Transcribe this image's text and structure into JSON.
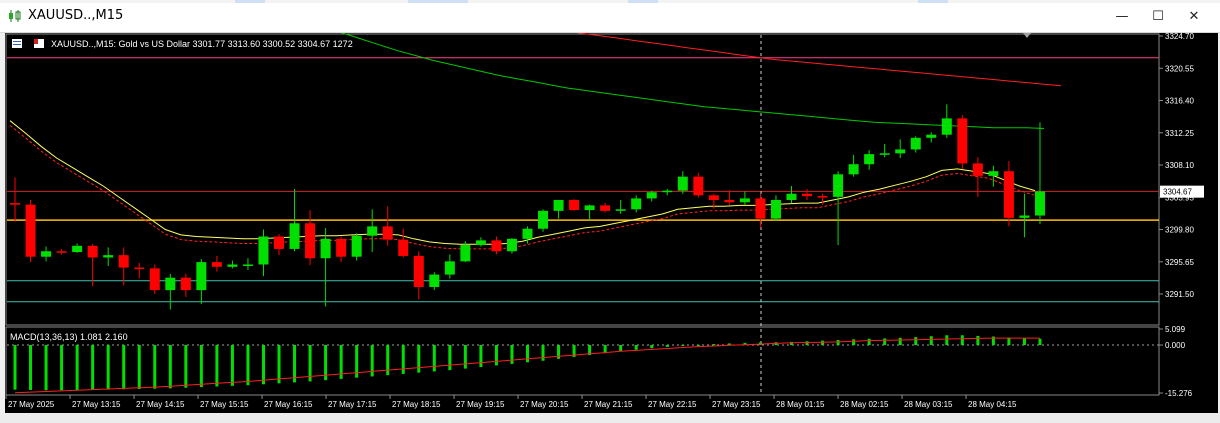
{
  "window": {
    "title": "XAUUSD..,M15",
    "minimize_glyph": "—",
    "maximize_glyph": "☐",
    "close_glyph": "✕"
  },
  "chart_header": {
    "symbol_text": "XAUUSD..,M15:  Gold vs US Dollar  3301.77 3313.60 3300.52 3304.67  1272"
  },
  "price_axis": {
    "labels": [
      "3324.70",
      "3320.55",
      "3316.40",
      "3312.25",
      "3308.10",
      "3303.95",
      "3299.80",
      "3295.65",
      "3291.50"
    ],
    "current_price": "3304.67"
  },
  "macd_panel": {
    "label": "MACD(13,36,13) 1.081 2.160",
    "axis_labels": [
      "5.099",
      "0.000",
      "-15.276"
    ]
  },
  "time_axis": {
    "labels": [
      "27 May 2025",
      "27 May 13:15",
      "27 May 14:15",
      "27 May 15:15",
      "27 May 16:15",
      "27 May 17:15",
      "27 May 18:15",
      "27 May 19:15",
      "27 May 20:15",
      "27 May 21:15",
      "27 May 22:15",
      "27 May 23:15",
      "28 May 01:15",
      "28 May 02:15",
      "28 May 03:15",
      "28 May 04:15"
    ]
  },
  "colors": {
    "background": "#000000",
    "bull": "#00e000",
    "bear": "#ff0000",
    "ma_fast": "#ffff66",
    "ma_slow": "#00c800",
    "ma_long": "#ff2020",
    "hline_magenta": "#ff3c8c",
    "hline_red": "#c82828",
    "hline_gold": "#ffc000",
    "hline_cyan": "#40c0b0",
    "macd_hist": "#00e000",
    "macd_signal": "#ff2020"
  },
  "chart_data": {
    "type": "candlestick",
    "y_range": [
      3289.5,
      3325.5
    ],
    "candles": [
      [
        3303.2,
        3306.5,
        3300.8,
        3303.0
      ],
      [
        3303.0,
        3303.6,
        3295.6,
        3296.3
      ],
      [
        3296.3,
        3297.6,
        3295.7,
        3297.0
      ],
      [
        3297.0,
        3297.3,
        3296.6,
        3296.9
      ],
      [
        3296.9,
        3298.0,
        3296.8,
        3297.7
      ],
      [
        3297.7,
        3297.9,
        3292.5,
        3296.2
      ],
      [
        3296.2,
        3297.5,
        3295.1,
        3296.5
      ],
      [
        3296.5,
        3297.5,
        3292.6,
        3294.9
      ],
      [
        3294.9,
        3295.5,
        3293.5,
        3294.8
      ],
      [
        3294.8,
        3295.3,
        3291.5,
        3292.0
      ],
      [
        3292.0,
        3294.1,
        3289.5,
        3293.6
      ],
      [
        3293.6,
        3294.1,
        3291.1,
        3292.0
      ],
      [
        3292.0,
        3296.0,
        3290.2,
        3295.6
      ],
      [
        3295.6,
        3296.4,
        3294.4,
        3295.0
      ],
      [
        3295.0,
        3295.8,
        3294.8,
        3295.3
      ],
      [
        3295.3,
        3296.1,
        3294.6,
        3295.3
      ],
      [
        3295.3,
        3299.8,
        3293.8,
        3298.9
      ],
      [
        3298.9,
        3299.2,
        3296.5,
        3297.3
      ],
      [
        3297.3,
        3305.0,
        3297.0,
        3300.6
      ],
      [
        3300.6,
        3302.3,
        3295.2,
        3296.1
      ],
      [
        3296.1,
        3300.0,
        3289.9,
        3298.6
      ],
      [
        3298.6,
        3298.9,
        3295.6,
        3296.3
      ],
      [
        3296.3,
        3299.3,
        3295.8,
        3299.0
      ],
      [
        3299.0,
        3302.4,
        3296.9,
        3300.2
      ],
      [
        3300.2,
        3302.8,
        3297.7,
        3298.5
      ],
      [
        3298.5,
        3299.9,
        3296.2,
        3296.4
      ],
      [
        3296.4,
        3297.0,
        3290.8,
        3292.4
      ],
      [
        3292.4,
        3294.3,
        3292.0,
        3294.0
      ],
      [
        3294.0,
        3296.6,
        3293.5,
        3295.7
      ],
      [
        3295.7,
        3298.3,
        3295.6,
        3297.8
      ],
      [
        3297.8,
        3298.8,
        3297.6,
        3298.4
      ],
      [
        3298.4,
        3298.9,
        3296.6,
        3297.0
      ],
      [
        3297.0,
        3298.7,
        3296.7,
        3298.6
      ],
      [
        3298.6,
        3300.2,
        3298.0,
        3299.9
      ],
      [
        3299.9,
        3302.4,
        3299.5,
        3302.2
      ],
      [
        3302.2,
        3303.0,
        3301.2,
        3303.6
      ],
      [
        3303.6,
        3303.7,
        3302.2,
        3302.3
      ],
      [
        3302.3,
        3303.0,
        3301.0,
        3302.9
      ],
      [
        3302.9,
        3303.2,
        3302.0,
        3302.2
      ],
      [
        3302.2,
        3303.6,
        3301.8,
        3302.4
      ],
      [
        3302.4,
        3304.2,
        3302.0,
        3303.8
      ],
      [
        3303.8,
        3304.8,
        3303.4,
        3304.6
      ],
      [
        3304.6,
        3305.0,
        3304.2,
        3304.8
      ],
      [
        3304.8,
        3307.3,
        3304.4,
        3306.6
      ],
      [
        3306.6,
        3307.1,
        3303.9,
        3304.2
      ],
      [
        3304.2,
        3304.4,
        3302.5,
        3303.6
      ],
      [
        3303.6,
        3304.9,
        3303.0,
        3303.3
      ],
      [
        3303.3,
        3304.7,
        3303.0,
        3303.8
      ],
      [
        3303.8,
        3304.4,
        3300.0,
        3301.2
      ],
      [
        3301.2,
        3304.2,
        3300.9,
        3303.6
      ],
      [
        3303.6,
        3305.4,
        3303.2,
        3304.4
      ],
      [
        3304.4,
        3305.0,
        3303.6,
        3304.1
      ],
      [
        3304.1,
        3304.4,
        3303.0,
        3304.0
      ],
      [
        3304.0,
        3307.3,
        3297.8,
        3306.9
      ],
      [
        3306.9,
        3309.4,
        3306.6,
        3308.2
      ],
      [
        3308.2,
        3310.0,
        3307.5,
        3309.5
      ],
      [
        3309.5,
        3310.8,
        3309.1,
        3309.6
      ],
      [
        3309.6,
        3311.4,
        3309.0,
        3310.1
      ],
      [
        3310.1,
        3311.8,
        3309.7,
        3311.6
      ],
      [
        3311.6,
        3312.3,
        3311.0,
        3312.0
      ],
      [
        3312.0,
        3315.9,
        3311.6,
        3314.1
      ],
      [
        3314.1,
        3314.5,
        3307.6,
        3308.3
      ],
      [
        3308.3,
        3309.1,
        3304.0,
        3306.7
      ],
      [
        3306.7,
        3308.0,
        3305.3,
        3307.3
      ],
      [
        3307.3,
        3308.6,
        3300.2,
        3301.3
      ],
      [
        3301.3,
        3304.4,
        3298.8,
        3301.6
      ],
      [
        3301.6,
        3313.6,
        3300.5,
        3304.7
      ]
    ],
    "horizontal_levels": [
      {
        "price": 3321.9,
        "color": "hline_magenta"
      },
      {
        "price": 3304.7,
        "color": "hline_red"
      },
      {
        "price": 3301.0,
        "color": "hline_gold"
      },
      {
        "price": 3293.2,
        "color": "hline_cyan"
      },
      {
        "price": 3290.5,
        "color": "hline_cyan"
      }
    ],
    "ma_fast": [
      3313.8,
      3312.2,
      3310.5,
      3309.0,
      3307.8,
      3306.6,
      3305.4,
      3304.0,
      3302.6,
      3301.2,
      3299.8,
      3299.1,
      3298.9,
      3298.8,
      3298.7,
      3298.6,
      3298.6,
      3298.7,
      3298.8,
      3298.9,
      3299.0,
      3299.0,
      3299.1,
      3299.2,
      3299.2,
      3299.1,
      3298.6,
      3298.2,
      3298.0,
      3297.9,
      3297.9,
      3297.9,
      3298.0,
      3298.3,
      3298.8,
      3299.2,
      3299.6,
      3300.0,
      3300.2,
      3300.6,
      3301.0,
      3301.4,
      3301.8,
      3302.4,
      3302.6,
      3302.8,
      3302.8,
      3302.9,
      3302.9,
      3303.0,
      3303.1,
      3303.2,
      3303.2,
      3303.6,
      3304.0,
      3304.6,
      3305.0,
      3305.5,
      3306.0,
      3306.6,
      3307.4,
      3307.6,
      3307.3,
      3307.0,
      3306.2,
      3305.4,
      3304.8
    ],
    "ma_slow": [
      3330.0,
      3329.0,
      3328.1,
      3327.2,
      3326.4,
      3325.6,
      3324.9,
      3324.2,
      3323.5,
      3322.8,
      3322.2,
      3321.6,
      3321.1,
      3320.6,
      3320.1,
      3319.6,
      3319.2,
      3318.8,
      3318.4,
      3318.0,
      3317.7,
      3317.4,
      3317.1,
      3316.8,
      3316.5,
      3316.2,
      3315.9,
      3315.6,
      3315.4,
      3315.2,
      3315.0,
      3314.8,
      3314.6,
      3314.4,
      3314.2,
      3314.0,
      3313.8,
      3313.6,
      3313.5,
      3313.4,
      3313.3,
      3313.2,
      3313.1,
      3313.0,
      3312.9,
      3312.9,
      3312.9,
      3312.8
    ],
    "ma_long": [
      3333.0,
      3332.5,
      3332.0,
      3331.5,
      3331.0,
      3330.5,
      3330.0,
      3329.6,
      3329.2,
      3328.8,
      3328.4,
      3328.0,
      3327.6,
      3327.2,
      3326.8,
      3326.5,
      3326.2,
      3325.9,
      3325.6,
      3325.3,
      3325.0,
      3324.7,
      3324.4,
      3324.1,
      3323.8,
      3323.5,
      3323.2,
      3322.9,
      3322.6,
      3322.3,
      3322.0,
      3321.7,
      3321.5,
      3321.3,
      3321.1,
      3320.9,
      3320.7,
      3320.5,
      3320.3,
      3320.1,
      3319.9,
      3319.7,
      3319.5,
      3319.3,
      3319.1,
      3318.9,
      3318.7,
      3318.5,
      3318.3
    ],
    "macd_range": [
      -15.276,
      5.099
    ],
    "macd_hist": [
      -14.2,
      -14.3,
      -14.4,
      -14.4,
      -14.4,
      -14.3,
      -14.2,
      -14.1,
      -14.0,
      -13.9,
      -13.8,
      -13.6,
      -13.4,
      -13.2,
      -13.0,
      -12.8,
      -12.5,
      -12.2,
      -11.9,
      -11.6,
      -11.2,
      -10.8,
      -10.4,
      -10.0,
      -9.6,
      -9.2,
      -8.8,
      -8.4,
      -8.0,
      -7.5,
      -7.0,
      -6.5,
      -6.0,
      -5.5,
      -5.0,
      -4.4,
      -3.8,
      -3.2,
      -2.6,
      -2.0,
      -1.5,
      -1.0,
      -0.6,
      -0.3,
      0.0,
      0.3,
      0.5,
      0.7,
      0.8,
      0.9,
      1.0,
      1.2,
      1.4,
      1.6,
      1.8,
      2.0,
      2.1,
      2.3,
      2.5,
      2.8,
      3.1,
      3.1,
      2.9,
      2.7,
      2.4,
      2.2,
      2.0
    ],
    "macd_signal": [
      -15.2,
      -15.0,
      -14.8,
      -14.6,
      -14.4,
      -14.2,
      -14.0,
      -13.8,
      -13.6,
      -13.4,
      -13.1,
      -12.8,
      -12.5,
      -12.2,
      -11.9,
      -11.6,
      -11.2,
      -10.8,
      -10.4,
      -10.0,
      -9.6,
      -9.2,
      -8.8,
      -8.4,
      -8.0,
      -7.6,
      -7.2,
      -6.8,
      -6.4,
      -6.0,
      -5.6,
      -5.2,
      -4.8,
      -4.4,
      -4.0,
      -3.6,
      -3.2,
      -2.8,
      -2.4,
      -2.0,
      -1.7,
      -1.4,
      -1.1,
      -0.8,
      -0.5,
      -0.3,
      -0.1,
      0.1,
      0.3,
      0.5,
      0.7,
      0.8,
      0.9,
      1.0,
      1.2,
      1.4,
      1.5,
      1.6,
      1.7,
      1.8,
      1.9,
      2.0,
      2.1,
      2.2,
      2.2,
      2.2,
      2.2
    ]
  }
}
